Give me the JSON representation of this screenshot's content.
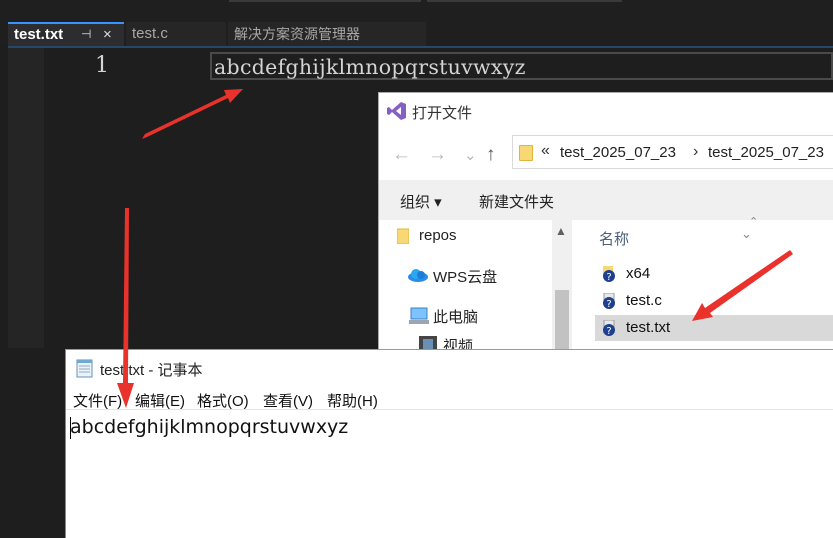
{
  "editor": {
    "tabs": [
      {
        "label": "test.txt",
        "pin": "⊣",
        "close": "×"
      },
      {
        "label": "test.c"
      },
      {
        "label": "解决方案资源管理器"
      }
    ],
    "line_number": "1",
    "code_line": "abcdefghijklmnopqrstuvwxyz"
  },
  "open_dialog": {
    "title": "打开文件",
    "nav": {
      "back": "←",
      "forward": "→",
      "recent": "⌄",
      "up": "↑"
    },
    "address": {
      "chevron": "«",
      "crumbs": [
        "test_2025_07_23",
        "test_2025_07_23"
      ],
      "sep": "›"
    },
    "toolbar": {
      "organize": "组织 ▾",
      "new_folder": "新建文件夹"
    },
    "nav_items": [
      "repos",
      "WPS云盘",
      "此电脑",
      "视频"
    ],
    "column_header": "名称",
    "files": [
      "x64",
      "test.c",
      "test.txt"
    ],
    "selected_file": "test.txt"
  },
  "notepad": {
    "title": "test.txt - 记事本",
    "menu": [
      "文件(F)",
      "编辑(E)",
      "格式(O)",
      "查看(V)",
      "帮助(H)"
    ],
    "content": "abcdefghijklmnopqrstuvwxyz"
  },
  "colors": {
    "editor_bg": "#1e1e1e",
    "tab_accent": "#3794ff",
    "arrow": "#e8322b",
    "selected_row": "#d9d9d9"
  }
}
